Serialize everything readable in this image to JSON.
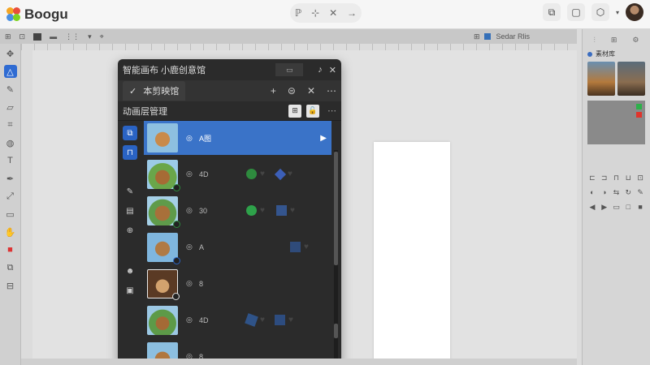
{
  "app": {
    "name": "Boogu"
  },
  "colors": {
    "accent": "#2f6bd2",
    "panel_bg": "#2b2b2b",
    "selected": "#3a73c8"
  },
  "titlebar": {
    "center_tools": [
      "ℙ",
      "⊹",
      "✕",
      "→"
    ],
    "right_tools": [
      "copy-icon",
      "comment-icon",
      "plugin-icon"
    ]
  },
  "subbar": {
    "label": "Sedar Rlis"
  },
  "panel": {
    "title": "智能画布 小鹿创意馆",
    "tab_label": "本剪映馆",
    "section_title": "动画层管理",
    "layers": [
      {
        "name": "A图",
        "selected": true
      },
      {
        "name": "4D",
        "selected": false
      },
      {
        "name": "30",
        "selected": false
      },
      {
        "name": "A",
        "selected": false
      },
      {
        "name": "8",
        "selected": false
      },
      {
        "name": "4D",
        "selected": false
      },
      {
        "name": "8",
        "selected": false
      }
    ]
  },
  "right_panel": {
    "title": "素材库"
  }
}
